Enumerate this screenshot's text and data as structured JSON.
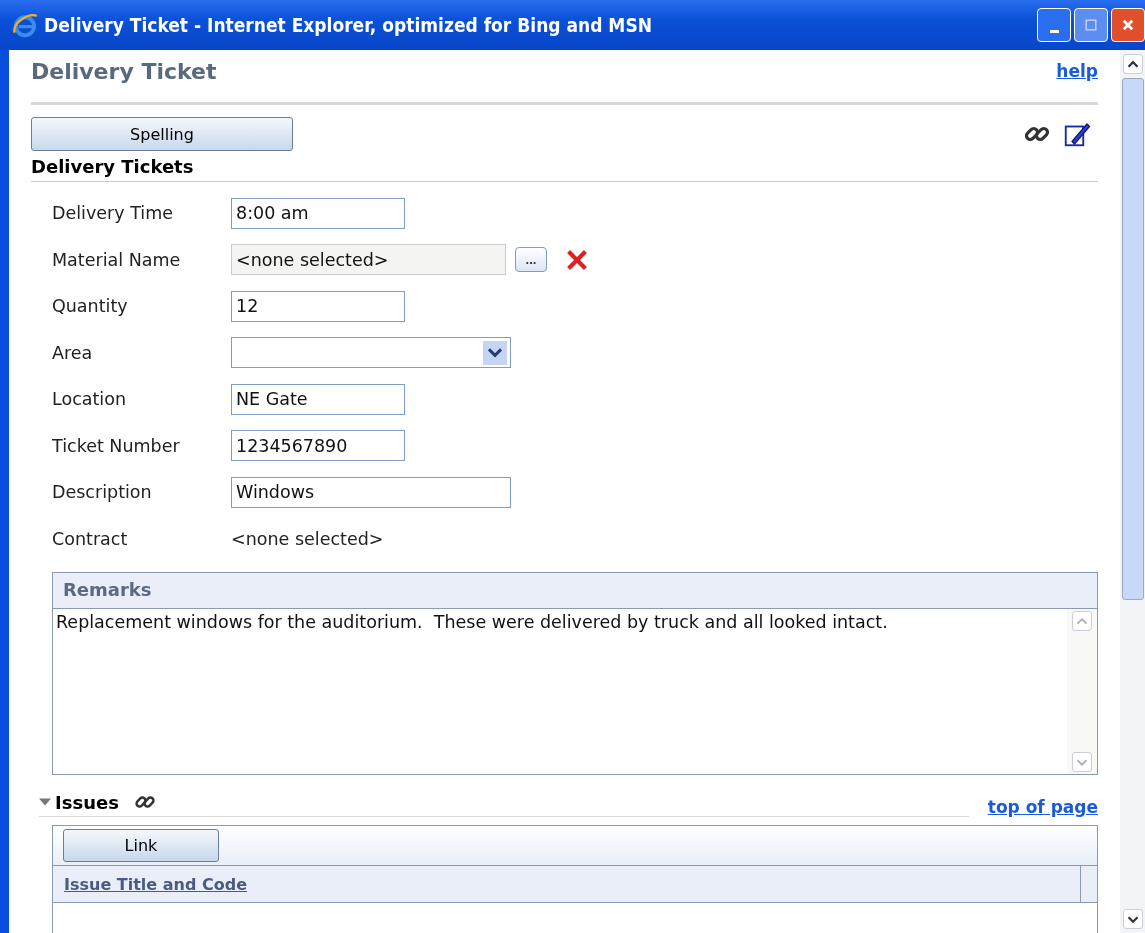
{
  "window": {
    "title": "Delivery Ticket - Internet Explorer, optimized for Bing and MSN"
  },
  "page": {
    "title": "Delivery Ticket",
    "help": "help"
  },
  "toolbar": {
    "button": "Spelling"
  },
  "section": {
    "title": "Delivery Tickets"
  },
  "fields": [
    {
      "label": "Delivery Time",
      "kind": "text",
      "value": "8:00 am"
    },
    {
      "label": "Material Name",
      "kind": "lookup",
      "value": "<none selected>",
      "browse": "..."
    },
    {
      "label": "Quantity",
      "kind": "text",
      "value": "12"
    },
    {
      "label": "Area",
      "kind": "select"
    },
    {
      "label": "Location",
      "kind": "text",
      "value": "NE Gate"
    },
    {
      "label": "Ticket Number",
      "kind": "text",
      "value": "1234567890"
    },
    {
      "label": "Description",
      "kind": "wide_text",
      "value": "Windows"
    },
    {
      "label": "Contract",
      "kind": "static",
      "value": "<none selected>"
    }
  ],
  "remarks": {
    "title": "Remarks",
    "value": "Replacement windows for the auditorium.  These were delivered by truck and all looked intact."
  },
  "issues": {
    "title": "Issues",
    "expanded": true,
    "top_link": "top of page",
    "button": "Link",
    "columns": [
      "Issue Title and Code"
    ]
  }
}
